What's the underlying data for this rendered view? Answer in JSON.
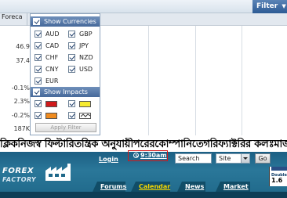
{
  "toolbar": {
    "filter_label": "Filter",
    "column_label": "Foreca"
  },
  "grid": {
    "values": [
      "46.9",
      "37.4",
      "-0.1%",
      "2.3%",
      "-0.2%",
      "187K"
    ]
  },
  "filter_panel": {
    "currencies_header": "Show Currencies",
    "currencies": [
      {
        "code": "AUD",
        "checked": true
      },
      {
        "code": "GBP",
        "checked": true
      },
      {
        "code": "CAD",
        "checked": true
      },
      {
        "code": "JPY",
        "checked": true
      },
      {
        "code": "CHF",
        "checked": true
      },
      {
        "code": "NZD",
        "checked": true
      },
      {
        "code": "CNY",
        "checked": true
      },
      {
        "code": "USD",
        "checked": true
      },
      {
        "code": "EUR",
        "checked": true
      }
    ],
    "impacts_header": "Show Impacts",
    "impacts": [
      {
        "name": "high",
        "color": "#d0191b",
        "checked": true
      },
      {
        "name": "medium",
        "color": "#f6ea2f",
        "checked": true
      },
      {
        "name": "low",
        "color": "#ef8b1f",
        "checked": true
      },
      {
        "name": "non-economic",
        "color": "#ffffff",
        "checked": true
      }
    ],
    "apply_label": "Apply Filter"
  },
  "garbled_band": "ক্লিকনিজস্ব ফিল্টারিতন্ত্রিক অনুযায়ীপরেরকোম্পানিতেগরিফ্যাক্টরির কলঃমাজ্যুক্তকরে",
  "header": {
    "logo_line1": "FOREX",
    "logo_line2": "FACTORY",
    "login_label": "Login",
    "time_label": "9:30am",
    "search_value": "Search",
    "site_option": "Site",
    "go_label": "Go",
    "ad_line1": "Double",
    "ad_value": "1.6"
  },
  "nav": {
    "tabs": [
      {
        "label": "Forums",
        "active": false
      },
      {
        "label": "Calendar",
        "active": true
      },
      {
        "label": "News",
        "active": false
      },
      {
        "label": "Market",
        "active": false
      }
    ]
  },
  "colors": {
    "header_blue": "#2a7799",
    "active_tab": "#f5d600",
    "time_box_border": "#d2191b"
  }
}
